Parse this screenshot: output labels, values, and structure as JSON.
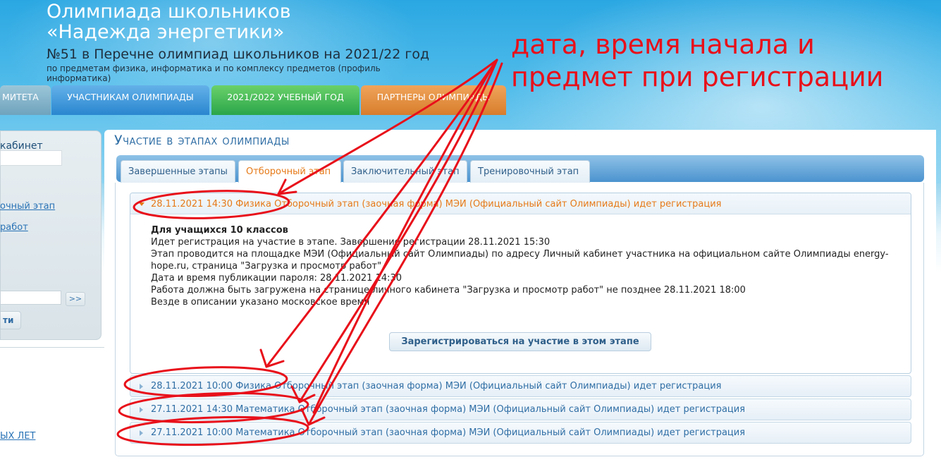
{
  "header": {
    "title_line1": "Олимпиада школьников",
    "title_line2": "«Надежда энергетики»",
    "subtitle": "№51 в Перечне олимпиад школьников на 2021/22 год",
    "description": "по предметам физика, информатика и по комплексу предметов (профиль информатика)"
  },
  "nav": {
    "committee": "МИТЕТА",
    "participants": "УЧАСТНИКАМ ОЛИМПИАДЫ",
    "year": "2021/2022 УЧЕБНЫЙ ГОД",
    "partners": "ПАРТНЕРЫ ОЛИМПИАДЫ"
  },
  "sidebar": {
    "cabinet_label": "кабинет",
    "link1": "очный этап",
    "link2": "работ",
    "go_label": ">>",
    "button_label": "ти",
    "bottom_link": "ЫХ ЛЕТ"
  },
  "main": {
    "page_title": "Участие в этапах олимпиады",
    "tabs": [
      {
        "label": "Завершенные этапы"
      },
      {
        "label": "Отборочный этап"
      },
      {
        "label": "Заключительный этап"
      },
      {
        "label": "Тренировочный этап"
      }
    ],
    "open_item": {
      "title": "28.11.2021 14:30 Физика Отборочный этап (заочная форма) МЭИ (Официальный сайт Олимпиады) идет регистрация",
      "details": [
        "Для учащихся 10 классов",
        "Идет регистрация на участие в этапе. Завершение регистрации 28.11.2021 15:30",
        "Этап проводится на площадке МЭИ (Официальный сайт Олимпиады) по адресу Личный кабинет участника на официальном сайте Олимпиады energy-hope.ru, страница \"Загрузка и просмотр работ\"",
        "Дата и время публикации пароля: 28.11.2021 14:30",
        "Работа должна быть загружена на странице личного кабинета \"Загрузка и просмотр работ\" не позднее 28.11.2021 18:00",
        "Везде в описании указано московское время"
      ],
      "register_button": "Зарегистрироваться на участие в этом этапе"
    },
    "collapsed_items": [
      {
        "title": "28.11.2021 10:00 Физика Отборочный этап (заочная форма) МЭИ (Официальный сайт Олимпиады) идет регистрация"
      },
      {
        "title": "27.11.2021 14:30 Математика Отборочный этап (заочная форма) МЭИ (Официальный сайт Олимпиады) идет регистрация"
      },
      {
        "title": "27.11.2021 10:00 Математика Отборочный этап (заочная форма) МЭИ (Официальный сайт Олимпиады) идет регистрация"
      }
    ]
  },
  "annotation": {
    "line1": "дата, время начала и",
    "line2": "предмет при регистрации",
    "color": "#e8101a"
  }
}
